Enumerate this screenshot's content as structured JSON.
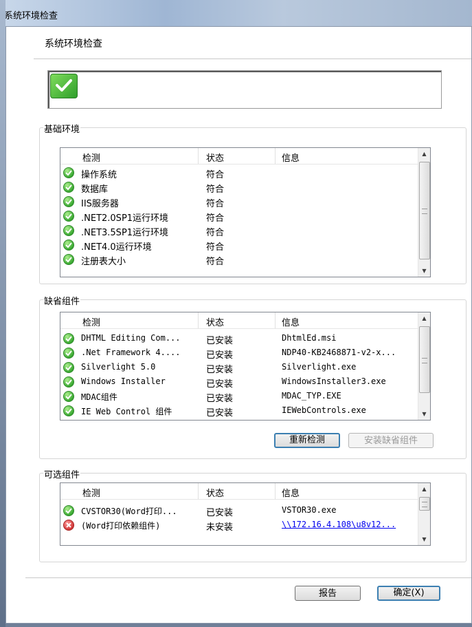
{
  "window": {
    "title": "系统环境检查"
  },
  "heading": "系统环境检查",
  "basic": {
    "label": "基础环境",
    "columns": [
      "检测",
      "状态",
      "信息"
    ],
    "rows": [
      {
        "name": "操作系统",
        "status": "符合",
        "info": "",
        "icon": "check-icon"
      },
      {
        "name": "数据库",
        "status": "符合",
        "info": "",
        "icon": "check-icon"
      },
      {
        "name": "IIS服务器",
        "status": "符合",
        "info": "",
        "icon": "check-icon"
      },
      {
        "name": ".NET2.0SP1运行环境",
        "status": "符合",
        "info": "",
        "icon": "check-icon"
      },
      {
        "name": ".NET3.5SP1运行环境",
        "status": "符合",
        "info": "",
        "icon": "check-icon"
      },
      {
        "name": ".NET4.0运行环境",
        "status": "符合",
        "info": "",
        "icon": "check-icon"
      },
      {
        "name": "注册表大小",
        "status": "符合",
        "info": "",
        "icon": "check-icon"
      }
    ]
  },
  "default_components": {
    "label": "缺省组件",
    "columns": [
      "检测",
      "状态",
      "信息"
    ],
    "rows": [
      {
        "name": "DHTML Editing Com...",
        "status": "已安装",
        "info": "DhtmlEd.msi",
        "icon": "check-icon"
      },
      {
        "name": ".Net Framework 4....",
        "status": "已安装",
        "info": "NDP40-KB2468871-v2-x...",
        "icon": "check-icon"
      },
      {
        "name": "Silverlight 5.0",
        "status": "已安装",
        "info": "Silverlight.exe",
        "icon": "check-icon"
      },
      {
        "name": "Windows Installer",
        "status": "已安装",
        "info": "WindowsInstaller3.exe",
        "icon": "check-icon"
      },
      {
        "name": "MDAC组件",
        "status": "已安装",
        "info": "MDAC_TYP.EXE",
        "icon": "check-icon"
      },
      {
        "name": "IE Web Control 组件",
        "status": "已安装",
        "info": "IEWebControls.exe",
        "icon": "check-icon"
      }
    ],
    "recheck_button": "重新检测",
    "install_button": "安装缺省组件"
  },
  "optional_components": {
    "label": "可选组件",
    "columns": [
      "检测",
      "状态",
      "信息"
    ],
    "rows": [
      {
        "name": "CVSTOR30(Word打印...",
        "status": "已安装",
        "info": "VSTOR30.exe",
        "icon": "check-icon"
      },
      {
        "name": "(Word打印依赖组件)",
        "status": "未安装",
        "info": "\\\\172.16.4.108\\u8v12...",
        "icon": "error-icon"
      }
    ]
  },
  "footer": {
    "report_button": "报告",
    "ok_button": "确定(X)"
  },
  "colors": {
    "ok": "#3aa832",
    "error": "#d23a3a",
    "link": "#0000ee",
    "accent": "#3c7fb1"
  }
}
